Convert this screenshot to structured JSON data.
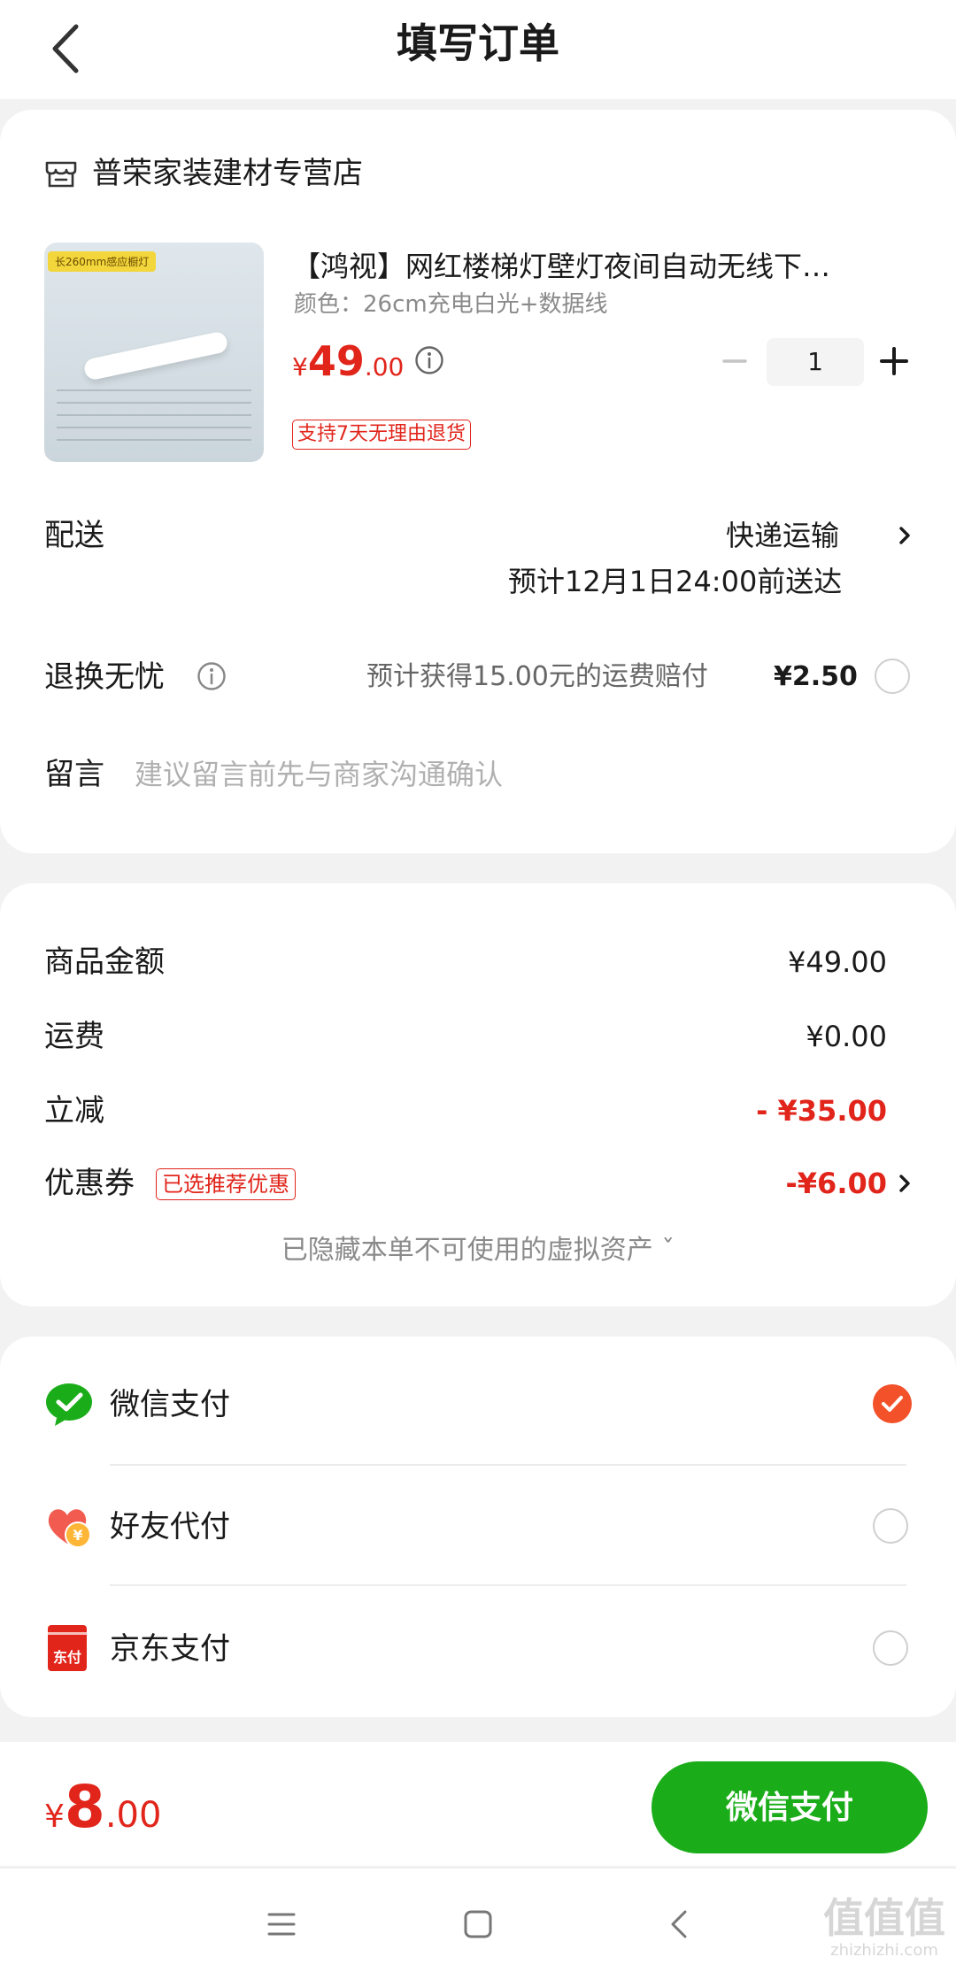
{
  "header": {
    "title": "填写订单"
  },
  "store": {
    "name": "普荣家装建材专营店"
  },
  "product": {
    "image_tag": "长260mm感应橱灯",
    "title": "【鸿视】网红楼梯灯壁灯夜间自动无线下…",
    "variant": "颜色：26cm充电白光+数据线",
    "price_yen": "¥",
    "price_int": "49",
    "price_dec": ".00",
    "quantity": "1",
    "return_policy": "支持7天无理由退货"
  },
  "delivery": {
    "label": "配送",
    "method": "快递运输",
    "eta": "预计12月1日24:00前送达"
  },
  "return_insurance": {
    "label": "退换无忧",
    "desc": "预计获得15.00元的运费赔付",
    "price": "¥2.50"
  },
  "message": {
    "label": "留言",
    "placeholder": "建议留言前先与商家沟通确认"
  },
  "summary": {
    "goods_label": "商品金额",
    "goods_value": "¥49.00",
    "shipping_label": "运费",
    "shipping_value": "¥0.00",
    "discount_label": "立减",
    "discount_value": "- ¥35.00",
    "coupon_label": "优惠券",
    "coupon_badge": "已选推荐优惠",
    "coupon_value": "-¥6.00",
    "hidden_note": "已隐藏本单不可使用的虚拟资产 ˇ"
  },
  "payment": {
    "options": [
      {
        "label": "微信支付",
        "icon": "wechat-pay-icon",
        "selected": true
      },
      {
        "label": "好友代付",
        "icon": "friend-pay-icon",
        "selected": false
      },
      {
        "label": "京东支付",
        "icon": "jd-pay-icon",
        "selected": false,
        "icon_text": "东付"
      }
    ]
  },
  "footer": {
    "total_yen": "¥",
    "total_int": "8",
    "total_dec": ".00",
    "pay_button": "微信支付"
  },
  "watermark": {
    "mark": "值值值",
    "url": "zhizhizhi.com"
  },
  "colors": {
    "accent_red": "#e1251b",
    "wechat_green": "#1aad19",
    "selected_orange": "#f2512a"
  }
}
